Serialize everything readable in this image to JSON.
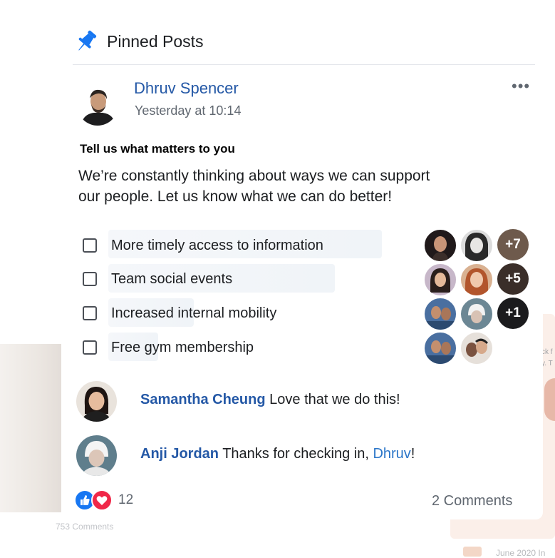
{
  "header": {
    "title": "Pinned Posts"
  },
  "post": {
    "author": "Dhruv Spencer",
    "timestamp": "Yesterday at 10:14",
    "title": "Tell us what matters to you",
    "body_line1": "We’re constantly thinking about ways we can support",
    "body_line2": "our people. Let us know what we can do better!",
    "more_label": "•••"
  },
  "poll": {
    "options": [
      {
        "label": "More timely access to information",
        "extra_voters": "+7"
      },
      {
        "label": "Team social events",
        "extra_voters": "+5"
      },
      {
        "label": "Increased internal mobility",
        "extra_voters": "+1"
      },
      {
        "label": "Free gym membership"
      }
    ]
  },
  "comments": [
    {
      "author": "Samantha Cheung",
      "text": "Love that we do this!"
    },
    {
      "author": "Anji Jordan",
      "text_before": "Thanks for checking in, ",
      "mention": "Dhruv",
      "text_after": "!"
    }
  ],
  "footer": {
    "reaction_count": "12",
    "comments_label": "2 Comments"
  },
  "background": {
    "left_comments": "753 Comments",
    "date": "June 2020 In",
    "side_line1": "ck f",
    "side_line2": "y. T"
  },
  "colors": {
    "link": "#2458a6",
    "like": "#1877f2",
    "love": "#f02849",
    "pin": "#1877f2"
  }
}
